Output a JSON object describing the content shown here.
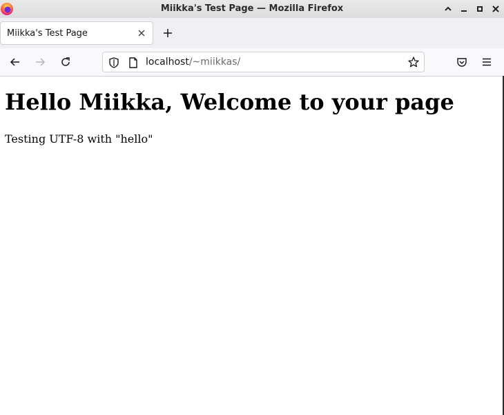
{
  "window": {
    "title": "Miikka's Test Page — Mozilla Firefox"
  },
  "tabs": [
    {
      "label": "Miikka's Test Page",
      "active": true
    }
  ],
  "urlbar": {
    "host": "localhost",
    "path": "/~miikkas/"
  },
  "page": {
    "heading": "Hello Miikka, Welcome to your page",
    "paragraph": "Testing UTF-8 with \"hello\""
  },
  "icons": {
    "browser_logo": "firefox-logo",
    "window_controls": [
      "collapse-up-icon",
      "minimize-icon",
      "maximize-icon",
      "close-icon"
    ],
    "tab_close": "close-icon",
    "new_tab": "plus-icon",
    "nav": [
      "back-arrow-icon",
      "forward-arrow-icon",
      "reload-icon"
    ],
    "url": [
      "shield-icon",
      "page-icon",
      "star-icon"
    ],
    "toolbar_right": [
      "pocket-icon",
      "hamburger-menu-icon"
    ]
  },
  "colors": {
    "tab_bar_bg": "#f0f0f4",
    "nav_bar_bg": "#f9f9fb",
    "url_path": "#6b6b70",
    "disabled_icon": "#b5b5bb"
  }
}
